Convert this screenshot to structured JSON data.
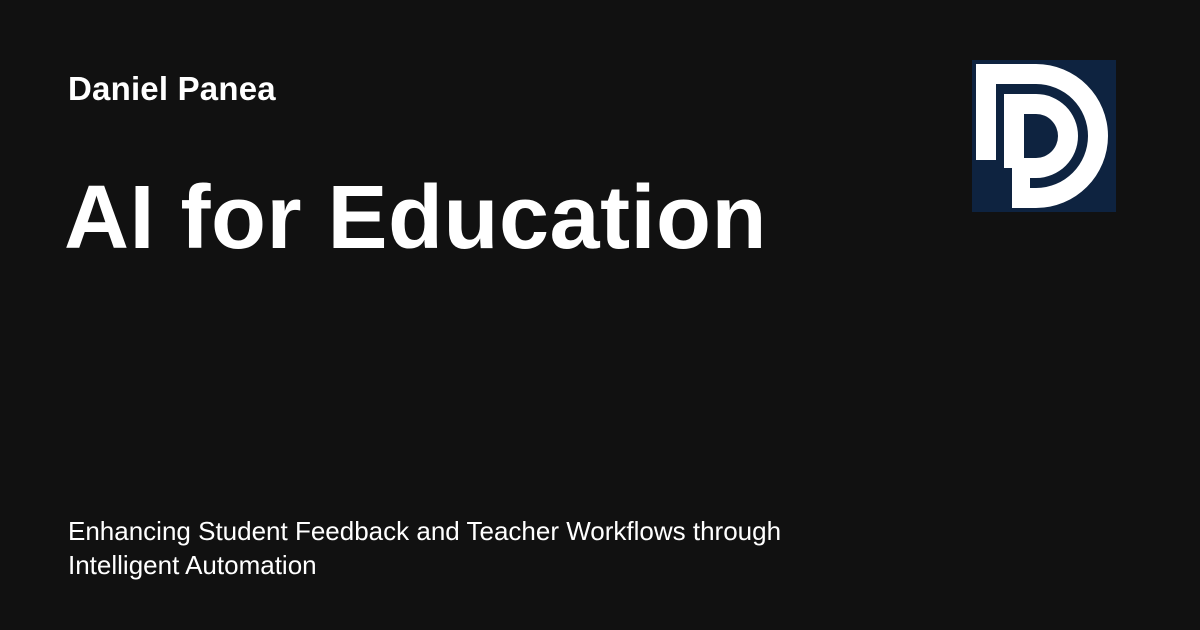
{
  "card": {
    "author": "Daniel Panea",
    "title": "AI for Education",
    "subtitle": "Enhancing Student Feedback and Teacher Workflows through Intelligent Automation"
  },
  "logo": {
    "icon": "dp-monogram-logo",
    "background_color": "#0e2340",
    "foreground_color": "#ffffff"
  },
  "colors": {
    "background": "#111111",
    "text": "#ffffff"
  }
}
